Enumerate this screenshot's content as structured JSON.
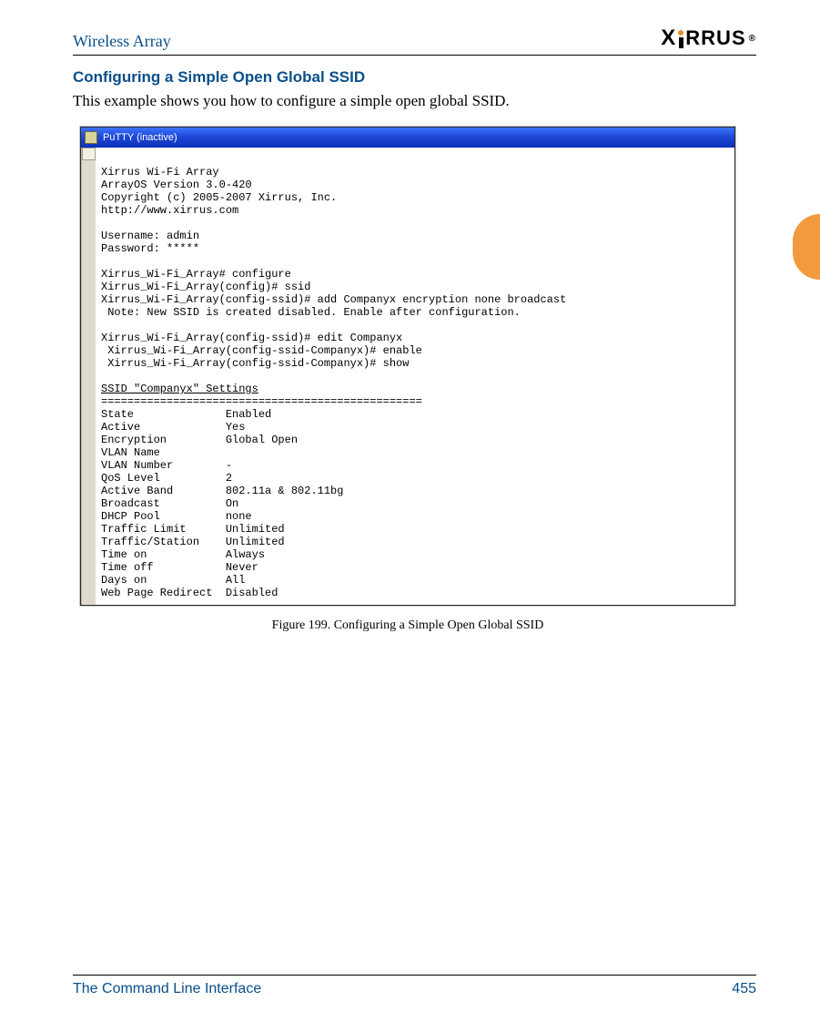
{
  "header": {
    "doc_title": "Wireless Array",
    "brand": "XIRRUS",
    "reg": "®"
  },
  "section": {
    "title": "Configuring a Simple Open Global SSID",
    "intro": "This example shows you how to configure a simple open global SSID."
  },
  "putty": {
    "window_title": "PuTTY (inactive)",
    "banner": [
      "Xirrus Wi-Fi Array",
      "ArrayOS Version 3.0-420",
      "Copyright (c) 2005-2007 Xirrus, Inc.",
      "http://www.xirrus.com"
    ],
    "login": {
      "user_label": "Username:",
      "user_value": "admin",
      "pass_label": "Password:",
      "pass_value": "*****"
    },
    "cmds": [
      "Xirrus_Wi-Fi_Array# configure",
      "Xirrus_Wi-Fi_Array(config)# ssid",
      "Xirrus_Wi-Fi_Array(config-ssid)# add Companyx encryption none broadcast",
      " Note: New SSID is created disabled. Enable after configuration.",
      "",
      "Xirrus_Wi-Fi_Array(config-ssid)# edit Companyx",
      " Xirrus_Wi-Fi_Array(config-ssid-Companyx)# enable",
      " Xirrus_Wi-Fi_Array(config-ssid-Companyx)# show"
    ],
    "settings_header": "SSID \"Companyx\" Settings",
    "settings_rule": "=================================================",
    "settings": [
      {
        "k": "State",
        "v": "Enabled"
      },
      {
        "k": "Active",
        "v": "Yes"
      },
      {
        "k": "Encryption",
        "v": "Global Open"
      },
      {
        "k": "VLAN Name",
        "v": ""
      },
      {
        "k": "VLAN Number",
        "v": "-"
      },
      {
        "k": "QoS Level",
        "v": "2"
      },
      {
        "k": "Active Band",
        "v": "802.11a & 802.11bg"
      },
      {
        "k": "Broadcast",
        "v": "On"
      },
      {
        "k": "DHCP Pool",
        "v": "none"
      },
      {
        "k": "Traffic Limit",
        "v": "Unlimited"
      },
      {
        "k": "Traffic/Station",
        "v": "Unlimited"
      },
      {
        "k": "Time on",
        "v": "Always"
      },
      {
        "k": "Time off",
        "v": "Never"
      },
      {
        "k": "Days on",
        "v": "All"
      },
      {
        "k": "Web Page Redirect",
        "v": "Disabled"
      }
    ]
  },
  "figure_caption": "Figure 199. Configuring a Simple Open Global SSID",
  "footer": {
    "section": "The Command Line Interface",
    "page": "455"
  }
}
